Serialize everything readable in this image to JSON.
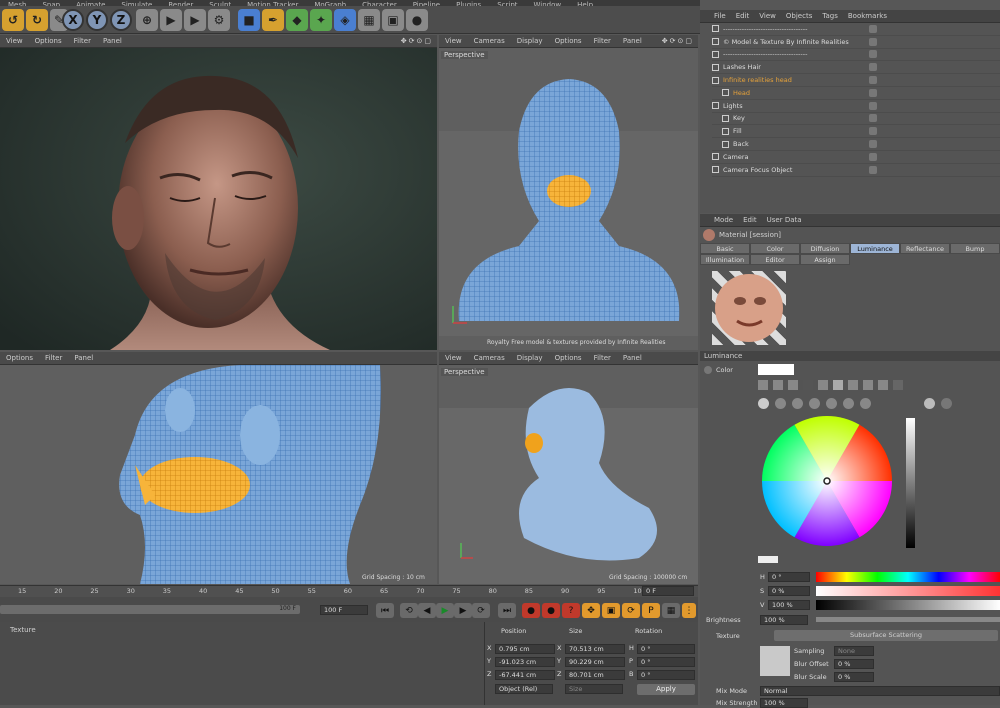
{
  "menu": [
    "Mesh",
    "Snap",
    "Animate",
    "Simulate",
    "Render",
    "Sculpt",
    "Motion Tracker",
    "MoGraph",
    "Character",
    "Pipeline",
    "Plugins",
    "Script",
    "Window",
    "Help"
  ],
  "viewport_menu_main": [
    "View",
    "Cameras",
    "Display",
    "Options",
    "Filter",
    "Panel"
  ],
  "viewport_menu_short": [
    "Options",
    "Filter",
    "Panel"
  ],
  "vp_persp": "Perspective",
  "vp_tr_footer": "Royalty Free model & textures provided by Infinite Realities",
  "vp_bl_footer": "Grid Spacing : 10 cm",
  "vp_br_footer": "Grid Spacing : 100000 cm",
  "toolbar": {
    "x": "X",
    "y": "Y",
    "z": "Z"
  },
  "objects_menu": [
    "File",
    "Edit",
    "View",
    "Objects",
    "Tags",
    "Bookmarks"
  ],
  "objects": [
    {
      "name": "------------------------------------",
      "indent": 0,
      "color": "#dddddd"
    },
    {
      "name": "© Model & Texture By Infinite Realities",
      "indent": 0,
      "color": "#dddddd"
    },
    {
      "name": "------------------------------------",
      "indent": 0,
      "color": "#dddddd"
    },
    {
      "name": "Lashes Hair",
      "indent": 0,
      "color": "#dddddd"
    },
    {
      "name": "Infinite realities head",
      "indent": 0,
      "color": "#e6a23a"
    },
    {
      "name": "Head",
      "indent": 1,
      "color": "#e6a23a"
    },
    {
      "name": "Lights",
      "indent": 0,
      "color": "#dddddd"
    },
    {
      "name": "Key",
      "indent": 1,
      "color": "#dddddd"
    },
    {
      "name": "Fill",
      "indent": 1,
      "color": "#dddddd"
    },
    {
      "name": "Back",
      "indent": 1,
      "color": "#dddddd"
    },
    {
      "name": "Camera",
      "indent": 0,
      "color": "#dddddd"
    },
    {
      "name": "Camera Focus Object",
      "indent": 0,
      "color": "#dddddd"
    }
  ],
  "attr_menu": [
    "Mode",
    "Edit",
    "User Data"
  ],
  "material_name": "Material [session]",
  "mat_tabs_row1": [
    "Basic",
    "Color",
    "Diffusion",
    "Luminance",
    "Reflectance",
    "Bump"
  ],
  "mat_tabs_row2": [
    "Illumination",
    "Editor",
    "Assign"
  ],
  "luminance_title": "Luminance",
  "color_label": "Color",
  "hsv": {
    "h_label": "H",
    "h_value": "0 °",
    "s_label": "S",
    "s_value": "0 %",
    "v_label": "V",
    "v_value": "100 %"
  },
  "brightness": {
    "label": "Brightness",
    "value": "100 %"
  },
  "texture": {
    "label": "Texture",
    "shader": "Subsurface Scattering"
  },
  "sampling": {
    "label": "Sampling",
    "value": "None"
  },
  "blur_offset": {
    "label": "Blur Offset",
    "value": "0 %"
  },
  "blur_scale": {
    "label": "Blur Scale",
    "value": "0 %"
  },
  "mix_mode": {
    "label": "Mix Mode",
    "value": "Normal"
  },
  "mix_strength": {
    "label": "Mix Strength",
    "value": "100 %"
  },
  "timeline_ticks": [
    "15",
    "20",
    "25",
    "30",
    "35",
    "40",
    "45",
    "50",
    "55",
    "60",
    "65",
    "70",
    "75",
    "80",
    "85",
    "90",
    "95",
    "100"
  ],
  "timeline": {
    "end_field": "100 F",
    "max_field": "100 F",
    "current_frame": "0 F",
    "slider_end": "100 F"
  },
  "coords": {
    "headers": [
      "Position",
      "Size",
      "Rotation"
    ],
    "rows": [
      {
        "axis": "X",
        "pos": "0.795 cm",
        "size_axis": "X",
        "size": "70.513 cm",
        "rot_axis": "H",
        "rot": "0 °"
      },
      {
        "axis": "Y",
        "pos": "-91.023 cm",
        "size_axis": "Y",
        "size": "90.229 cm",
        "rot_axis": "P",
        "rot": "0 °"
      },
      {
        "axis": "Z",
        "pos": "-67.441 cm",
        "size_axis": "Z",
        "size": "80.701 cm",
        "rot_axis": "B",
        "rot": "0 °"
      }
    ],
    "mode": "Object (Rel)",
    "size_mode": "Size",
    "apply": "Apply"
  },
  "material_manager_tab": "Texture",
  "colors": {
    "accent": "#9db5d6",
    "wire": "#5b9bd8",
    "mouth": "#f0a21c",
    "bg": "#575757"
  }
}
